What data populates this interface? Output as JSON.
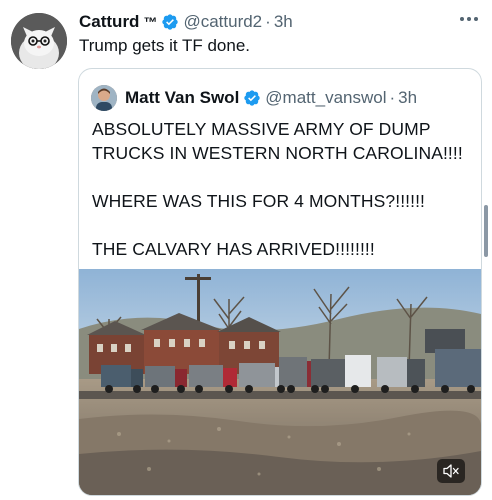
{
  "tweet": {
    "author_name": "Catturd",
    "author_tm": "™",
    "handle": "@catturd2",
    "separator": "·",
    "time": "3h",
    "text": "Trump gets it TF done.",
    "avatar_icon": "cat-avatar-icon",
    "verified_color": "#1d9bf0"
  },
  "quoted": {
    "author_name": "Matt Van Swol",
    "handle": "@matt_vanswol",
    "separator": "·",
    "time": "3h",
    "lines": [
      "ABSOLUTELY MASSIVE ARMY OF DUMP",
      "TRUCKS IN WESTERN NORTH CAROLINA!!!!",
      "WHERE WAS THIS FOR 4 MONTHS?!!!!!!",
      "THE CALVARY HAS ARRIVED!!!!!!!!"
    ],
    "media": {
      "icon": "mute-icon",
      "description_icon": "dump-trucks-video-thumbnail"
    }
  }
}
